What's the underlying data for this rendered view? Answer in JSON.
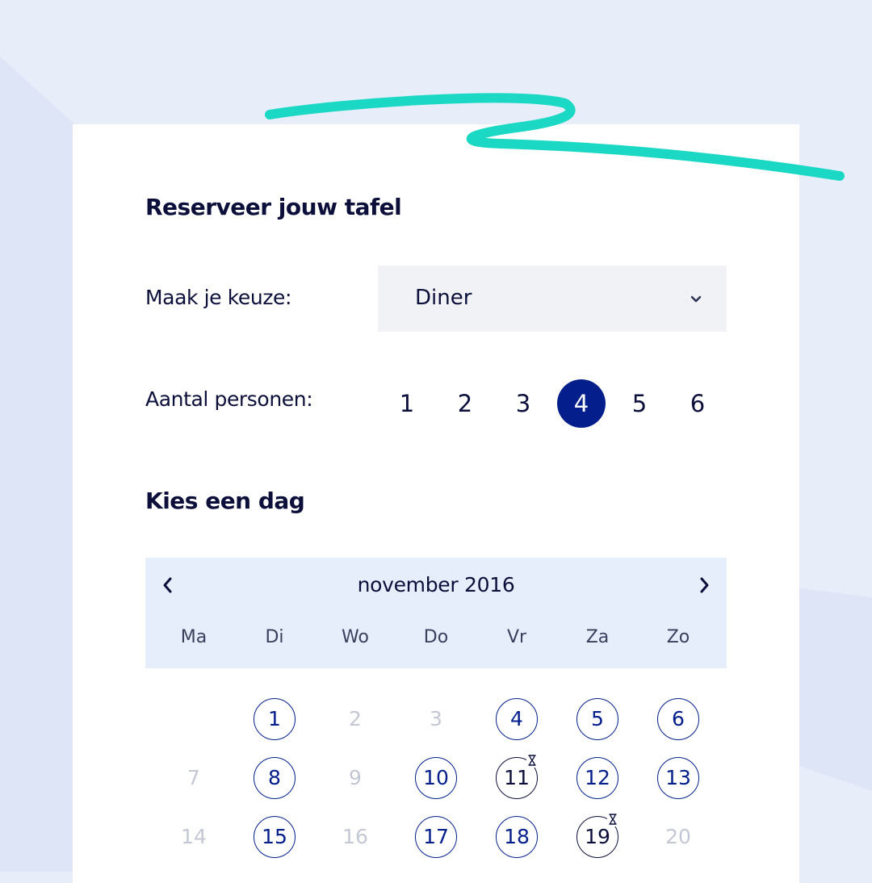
{
  "colors": {
    "background": "#e7eefa",
    "accent_squiggle": "#1ad8c4",
    "primary": "#041f8c",
    "text": "#0b0f3a",
    "disabled": "#c4c8d4",
    "select_bg": "#f0f2f6",
    "calendar_header_bg": "#e6edfb"
  },
  "form": {
    "title": "Reserveer jouw tafel",
    "choice_label": "Maak je keuze:",
    "choice_value": "Diner",
    "persons_label": "Aantal personen:",
    "persons": [
      "1",
      "2",
      "3",
      "4",
      "5",
      "6"
    ],
    "persons_selected": "4",
    "day_title": "Kies een dag"
  },
  "calendar": {
    "month_label": "november 2016",
    "prev_icon": "chevron-left-icon",
    "next_icon": "chevron-right-icon",
    "weekdays": [
      "Ma",
      "Di",
      "Wo",
      "Do",
      "Vr",
      "Za",
      "Zo"
    ],
    "leading_blanks": 1,
    "days": [
      {
        "label": "1",
        "status": "available"
      },
      {
        "label": "2",
        "status": "disabled"
      },
      {
        "label": "3",
        "status": "disabled"
      },
      {
        "label": "4",
        "status": "available"
      },
      {
        "label": "5",
        "status": "available"
      },
      {
        "label": "6",
        "status": "available"
      },
      {
        "label": "7",
        "status": "disabled"
      },
      {
        "label": "8",
        "status": "available"
      },
      {
        "label": "9",
        "status": "disabled"
      },
      {
        "label": "10",
        "status": "available"
      },
      {
        "label": "11",
        "status": "limited",
        "icon": "hourglass-icon"
      },
      {
        "label": "12",
        "status": "available"
      },
      {
        "label": "13",
        "status": "available"
      },
      {
        "label": "14",
        "status": "disabled"
      },
      {
        "label": "15",
        "status": "available"
      },
      {
        "label": "16",
        "status": "disabled"
      },
      {
        "label": "17",
        "status": "available"
      },
      {
        "label": "18",
        "status": "available"
      },
      {
        "label": "19",
        "status": "limited",
        "icon": "hourglass-icon"
      },
      {
        "label": "20",
        "status": "disabled"
      }
    ]
  }
}
